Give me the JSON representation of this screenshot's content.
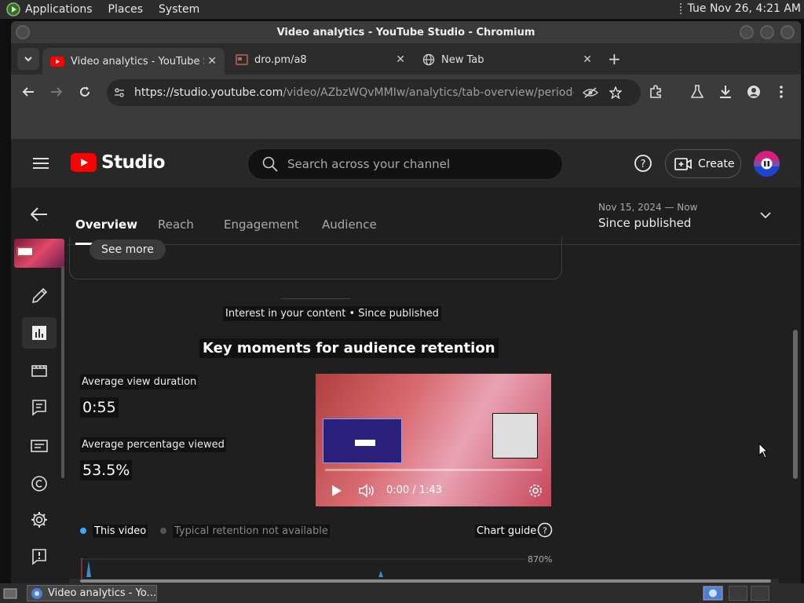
{
  "os": {
    "menu": [
      "Applications",
      "Places",
      "System"
    ],
    "clock": "Tue Nov 26,  4:21 AM"
  },
  "window": {
    "title": "Video analytics - YouTube Studio - Chromium"
  },
  "browser": {
    "tabs": [
      {
        "title": "Video analytics - YouTube Studio",
        "icon": "youtube-icon",
        "active": true
      },
      {
        "title": "dro.pm/a8",
        "icon": "page-icon",
        "active": false
      },
      {
        "title": "New Tab",
        "icon": "globe-icon",
        "active": false
      }
    ],
    "url_host": "https://studio.youtube.com",
    "url_path": "/video/AZbzWQvMMIw/analytics/tab-overview/period-default"
  },
  "studio": {
    "logo_text": "Studio",
    "search_placeholder": "Search across your channel",
    "create_label": "Create",
    "tabs": [
      "Overview",
      "Reach",
      "Engagement",
      "Audience"
    ],
    "period_range": "Nov 15, 2024 — Now",
    "period_label": "Since published",
    "see_more": "See more",
    "section_subtitle": "Interest in your content • Since published",
    "section_title": "Key moments for audience retention",
    "avg_view_duration_label": "Average view duration",
    "avg_view_duration": "0:55",
    "avg_pct_label": "Average percentage viewed",
    "avg_pct": "53.5%",
    "player_time": "0:00 / 1:43",
    "legend_this_video": "This video",
    "legend_typical": "Typical retention not available",
    "chart_guide": "Chart guide",
    "chart_max": "870%",
    "colors": {
      "this_video": "#3ea6ff",
      "typical": "#555555",
      "accent": "#ff0000"
    }
  },
  "taskbar": {
    "item": "Video analytics - Yo..."
  }
}
